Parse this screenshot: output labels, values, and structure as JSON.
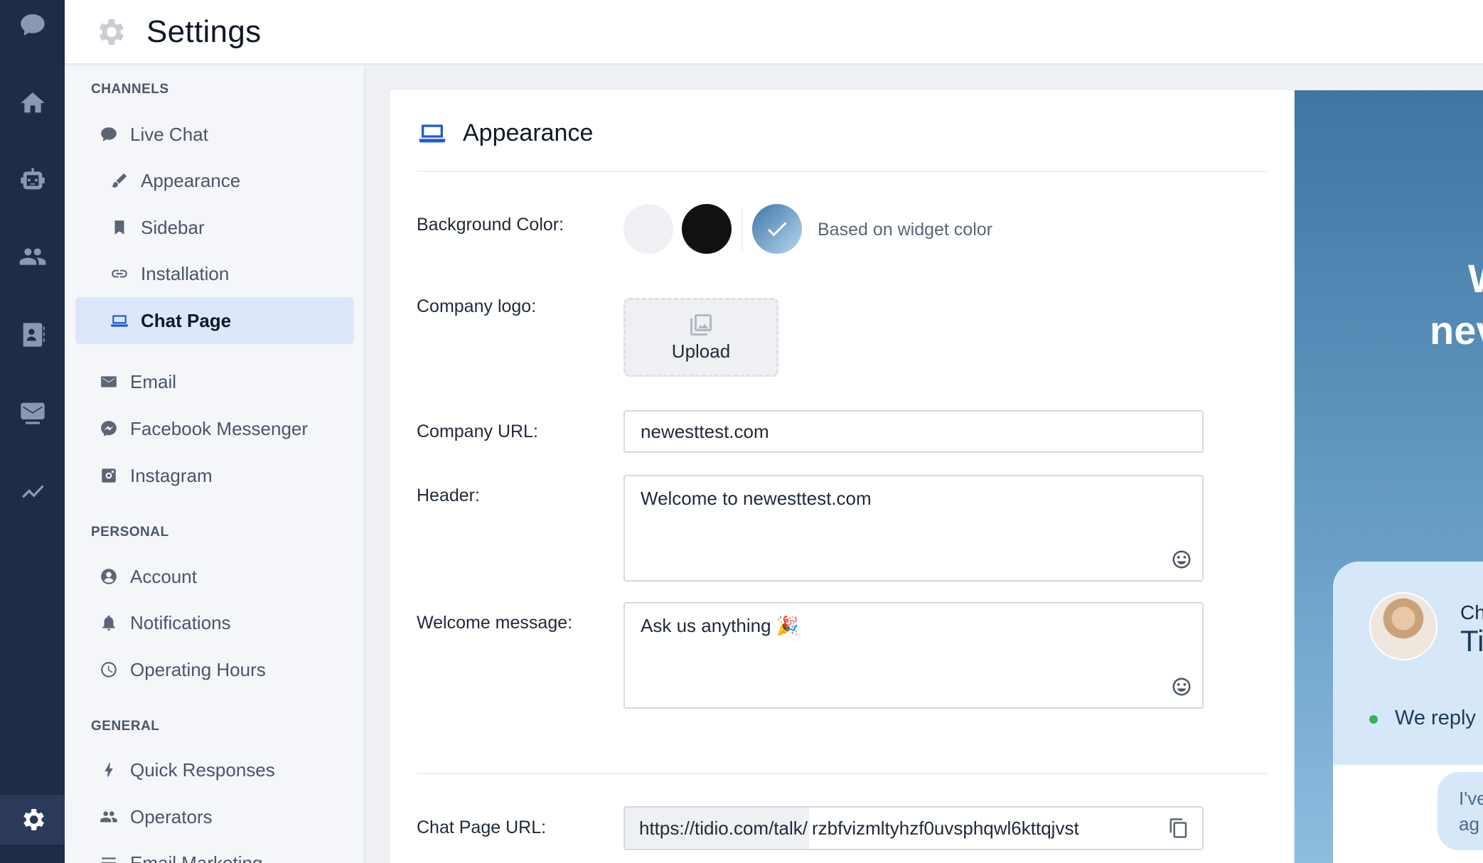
{
  "page": {
    "title": "Settings"
  },
  "nav": {
    "sections": {
      "channels": "CHANNELS",
      "personal": "PERSONAL",
      "general": "GENERAL"
    },
    "items": {
      "live_chat": "Live Chat",
      "appearance": "Appearance",
      "sidebar": "Sidebar",
      "installation": "Installation",
      "chat_page": "Chat Page",
      "email": "Email",
      "facebook": "Facebook Messenger",
      "instagram": "Instagram",
      "account": "Account",
      "notifications": "Notifications",
      "operating_hours": "Operating Hours",
      "quick_responses": "Quick Responses",
      "operators": "Operators",
      "email_marketing": "Email Marketing"
    },
    "active": "chat_page"
  },
  "appearance": {
    "title": "Appearance",
    "background_color_label": "Background Color:",
    "swatch_caption": "Based on widget color",
    "colors": {
      "light": "#eef0f4",
      "dark": "#111111",
      "accent": "#1f5bd6"
    },
    "company_logo_label": "Company logo:",
    "upload_label": "Upload",
    "company_url_label": "Company URL:",
    "company_url_value": "newesttest.com",
    "header_label": "Header:",
    "header_value": "Welcome to newesttest.com",
    "welcome_label": "Welcome message:",
    "welcome_value": "Ask us anything 🎉",
    "chat_page_url_label": "Chat Page URL:",
    "chat_page_url_prefix": "https://tidio.com/talk/",
    "chat_page_url_slug": "rzbfvizmltyhzf0uvsphqwl6kttqjvst"
  },
  "preview": {
    "heading_line1": "W",
    "heading_line2": "nev",
    "card_line1": "Ch",
    "card_line2": "Ti",
    "status": "We reply",
    "bubble_line1": "I've",
    "bubble_line2": "ag"
  }
}
